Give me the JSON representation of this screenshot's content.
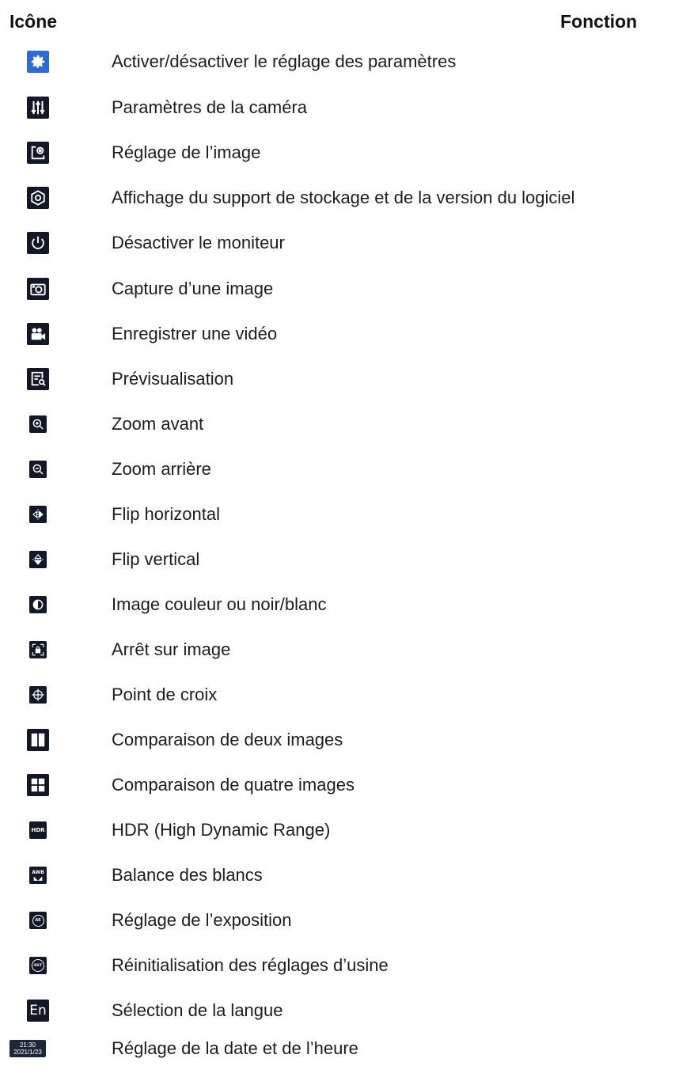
{
  "header": {
    "icon_col": "Icône",
    "function_col": "Fonction"
  },
  "rows": [
    {
      "icon": "gear-icon",
      "label": "Activer/désactiver le réglage des paramètres"
    },
    {
      "icon": "sliders-icon",
      "label": "Paramètres de la caméra"
    },
    {
      "icon": "image-settings-icon",
      "label": "Réglage de l’image"
    },
    {
      "icon": "storage-info-icon",
      "label": "Affichage du support de stockage et de la version du logiciel"
    },
    {
      "icon": "power-icon",
      "label": "Désactiver le moniteur"
    },
    {
      "icon": "camera-icon",
      "label": "Capture d’une image"
    },
    {
      "icon": "video-camera-icon",
      "label": "Enregistrer une vidéo"
    },
    {
      "icon": "preview-icon",
      "label": "Prévisualisation"
    },
    {
      "icon": "zoom-in-icon",
      "label": "Zoom avant"
    },
    {
      "icon": "zoom-out-icon",
      "label": "Zoom arrière"
    },
    {
      "icon": "flip-horizontal-icon",
      "label": "Flip horizontal"
    },
    {
      "icon": "flip-vertical-icon",
      "label": "Flip vertical"
    },
    {
      "icon": "contrast-icon",
      "label": "Image couleur ou noir/blanc"
    },
    {
      "icon": "freeze-icon",
      "label": "Arrêt sur image"
    },
    {
      "icon": "crosshair-icon",
      "label": "Point de croix"
    },
    {
      "icon": "split-two-icon",
      "label": "Comparaison de deux images"
    },
    {
      "icon": "split-four-icon",
      "label": "Comparaison de quatre images"
    },
    {
      "icon": "hdr-icon",
      "label": "HDR (High Dynamic Range)",
      "icon_text": "HDR"
    },
    {
      "icon": "awb-icon",
      "label": "Balance des blancs",
      "icon_text": "AWB"
    },
    {
      "icon": "exposure-icon",
      "label": "Réglage de l’exposition",
      "icon_text": "AE"
    },
    {
      "icon": "reset-icon",
      "label": "Réinitialisation des réglages d’usine",
      "icon_text": "RST"
    },
    {
      "icon": "language-icon",
      "label": "Sélection de la langue",
      "icon_text": "En"
    },
    {
      "icon": "datetime-icon",
      "label": "Réglage de la date et de l’heure",
      "icon_time": "21:30",
      "icon_date": "2021/1/23"
    }
  ],
  "colors": {
    "icon_bg": "#121826",
    "gear_bg": "#2d6bd2",
    "text": "#1c1c1c"
  }
}
